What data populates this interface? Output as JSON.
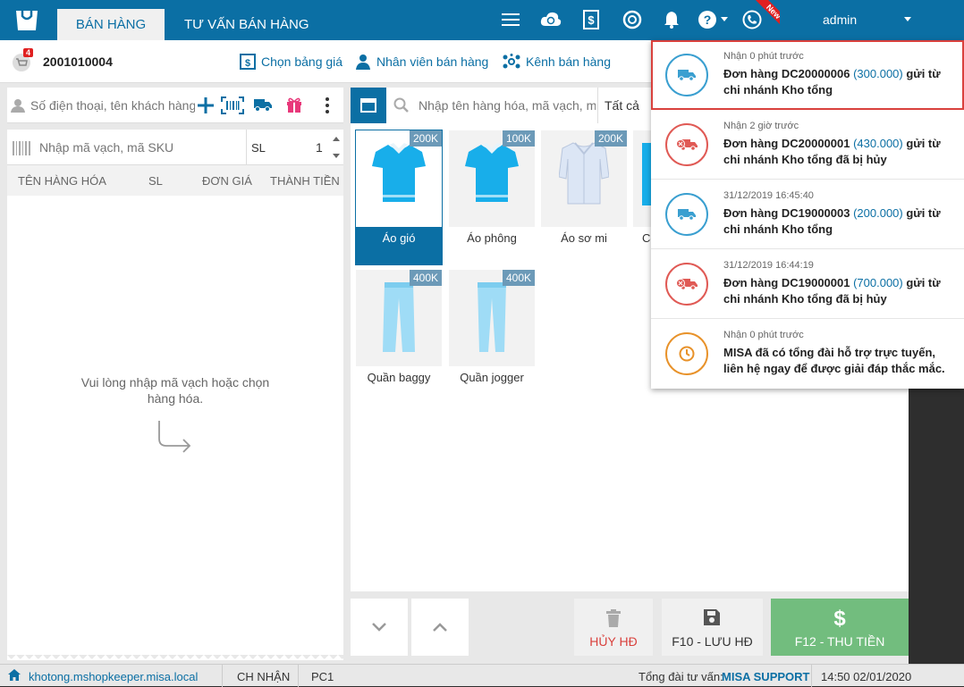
{
  "header": {
    "tabs": [
      {
        "label": "BÁN HÀNG"
      },
      {
        "label": "TƯ VẤN BÁN HÀNG"
      }
    ],
    "user": "admin",
    "new_tag": "New"
  },
  "toolbar": {
    "invoice_number": "2001010004",
    "cart_badge": "4",
    "price_list": "Chọn bảng giá",
    "staff": "Nhân viên bán hàng",
    "channel": "Kênh bán hàng"
  },
  "order": {
    "customer_placeholder": "Số điện thoại, tên khách hàng",
    "sku_placeholder": "Nhập mã vạch, mã SKU",
    "qty_label": "SL",
    "qty_value": "1",
    "columns": [
      "TÊN HÀNG HÓA",
      "SL",
      "ĐƠN GIÁ",
      "THÀNH TIỀN"
    ],
    "empty_line1": "Vui lòng nhập mã vạch hoặc chọn",
    "empty_line2": "hàng hóa."
  },
  "products": {
    "search_placeholder": "Nhập tên hàng hóa, mã vạch, mã",
    "filter": "Tất cả",
    "items": [
      {
        "name": "Áo gió",
        "price": "200K"
      },
      {
        "name": "Áo phông",
        "price": "100K"
      },
      {
        "name": "Áo sơ mi",
        "price": "200K"
      },
      {
        "name": "Co",
        "price": ""
      },
      {
        "name": "Quần baggy",
        "price": "400K"
      },
      {
        "name": "Quần jogger",
        "price": "400K"
      }
    ]
  },
  "actions": {
    "cancel": "HỦY HĐ",
    "save": "F10 - LƯU HĐ",
    "pay": "F12 - THU TIỀN"
  },
  "status": {
    "domain": "khotong.mshopkeeper.misa.local",
    "branch": "CH NHẬN",
    "pc": "PC1",
    "hotline_label": "Tổng đài tư vấn:",
    "hotline_name": "MISA SUPPORT",
    "datetime": "14:50 02/01/2020"
  },
  "notifications": [
    {
      "time": "Nhận 0 phút trước",
      "pre": "Đơn hàng DC20000006 ",
      "amount": "(300.000)",
      "post": " gửi từ chi nhánh Kho tổng",
      "kind": "delivery",
      "color": "#3a9fd0"
    },
    {
      "time": "Nhận 2 giờ trước",
      "pre": "Đơn hàng DC20000001 ",
      "amount": "(430.000)",
      "post": " gửi từ chi nhánh Kho tổng đã bị hủy",
      "kind": "cancelled",
      "color": "#e05a55"
    },
    {
      "time": "31/12/2019 16:45:40",
      "pre": "Đơn hàng DC19000003 ",
      "amount": "(200.000)",
      "post": " gửi từ chi nhánh Kho tổng",
      "kind": "delivery",
      "color": "#3a9fd0"
    },
    {
      "time": "31/12/2019 16:44:19",
      "pre": "Đơn hàng DC19000001 ",
      "amount": "(700.000)",
      "post": " gửi từ chi nhánh Kho tổng đã bị hủy",
      "kind": "cancelled",
      "color": "#e05a55"
    },
    {
      "time": "Nhận 0 phút trước",
      "pre": "MISA đã có tổng đài hỗ trợ trực tuyến, liên hệ ngay để được giải đáp thắc mắc.",
      "amount": "",
      "post": "",
      "kind": "support",
      "color": "#e8922a"
    }
  ],
  "colors": {
    "brand": "#0b6fa4",
    "pay": "#72bd7e",
    "danger": "#d9413d"
  }
}
